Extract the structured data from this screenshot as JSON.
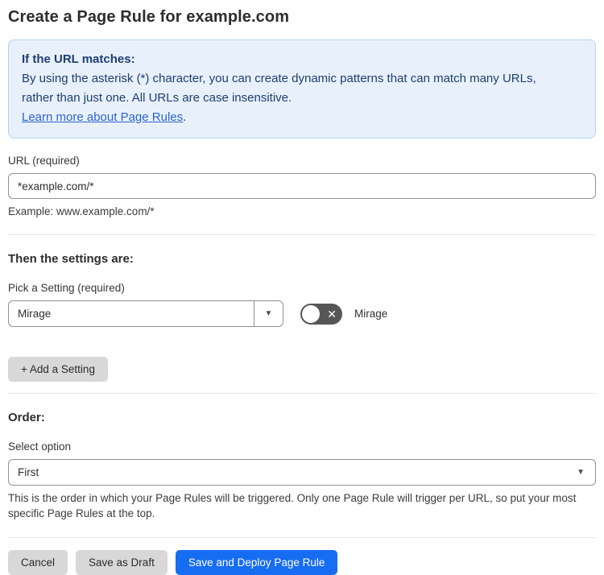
{
  "page": {
    "title": "Create a Page Rule for example.com"
  },
  "info_box": {
    "heading": "If the URL matches:",
    "body": "By using the asterisk (*) character, you can create dynamic patterns that can match many URLs, rather than just one. All URLs are case insensitive.",
    "link_label": "Learn more about Page Rules",
    "link_suffix": "."
  },
  "url_field": {
    "label": "URL (required)",
    "value": "*example.com/*",
    "helper": "Example: www.example.com/*"
  },
  "settings_section": {
    "heading": "Then the settings are:",
    "picker_label": "Pick a Setting (required)",
    "picker_value": "Mirage",
    "toggle_state": "off",
    "toggle_label": "Mirage",
    "add_setting_label": "+ Add a Setting"
  },
  "order_section": {
    "heading": "Order:",
    "select_label": "Select option",
    "select_value": "First",
    "helper": "This is the order in which your Page Rules will be triggered. Only one Page Rule will trigger per URL, so put your most specific Page Rules at the top."
  },
  "footer": {
    "cancel_label": "Cancel",
    "save_draft_label": "Save as Draft",
    "save_deploy_label": "Save and Deploy Page Rule"
  },
  "icons": {
    "dropdown_arrow": "▼",
    "select_caret": "▼",
    "toggle_off_x": "✕"
  },
  "colors": {
    "accent_blue": "#176df2",
    "info_bg": "#e8f1fb",
    "info_border": "#b6d1ef",
    "info_text": "#1e3d74",
    "link_blue": "#2d63cf",
    "toggle_off_bg": "#565656",
    "gray_button_bg": "#d8d8d8"
  }
}
